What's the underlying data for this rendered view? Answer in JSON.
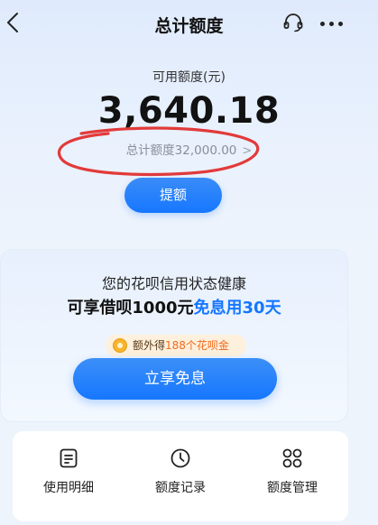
{
  "header": {
    "title": "总计额度"
  },
  "balance": {
    "available_label": "可用额度(元)",
    "available_amount": "3,640.18",
    "total_label": "总计额度32,000.00",
    "total_chevron": ">"
  },
  "actions": {
    "raise_label": "提额"
  },
  "promo": {
    "title": "您的花呗信用状态健康",
    "offer_prefix": "可享借呗1000元",
    "offer_highlight": "免息用30天",
    "bonus_prefix": "额外得",
    "bonus_amount": "188个花呗金",
    "cta_label": "立享免息"
  },
  "quick_links": [
    {
      "label": "使用明细",
      "icon": "document-list-icon"
    },
    {
      "label": "额度记录",
      "icon": "clock-icon"
    },
    {
      "label": "额度管理",
      "icon": "grid-icon"
    }
  ],
  "colors": {
    "accent": "#1677ff",
    "annotation": "#e23a3a",
    "bonus_text": "#f26a1b",
    "background": "#eef4fc"
  }
}
